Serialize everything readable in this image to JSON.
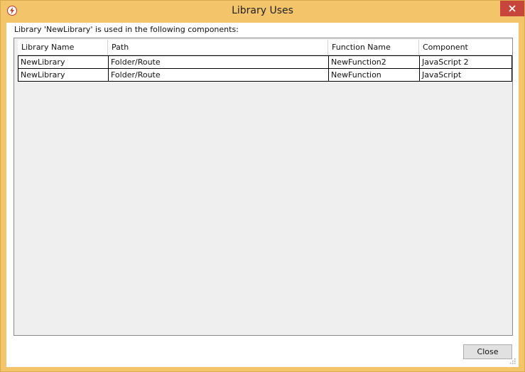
{
  "window": {
    "title": "Library Uses",
    "close_glyph": "✕",
    "accent": "#f3c46a",
    "close_color": "#c7453a"
  },
  "description": "Library 'NewLibrary' is used in the following components:",
  "grid": {
    "columns": [
      "Library Name",
      "Path",
      "Function Name",
      "Component"
    ],
    "rows": [
      [
        "NewLibrary",
        "Folder/Route",
        "NewFunction2",
        "JavaScript 2"
      ],
      [
        "NewLibrary",
        "Folder/Route",
        "NewFunction",
        "JavaScript"
      ]
    ]
  },
  "buttons": {
    "close_label": "Close"
  },
  "icons": {
    "app": "lightning-bolt-icon",
    "close": "close-icon",
    "resize": "resize-grip-icon"
  }
}
